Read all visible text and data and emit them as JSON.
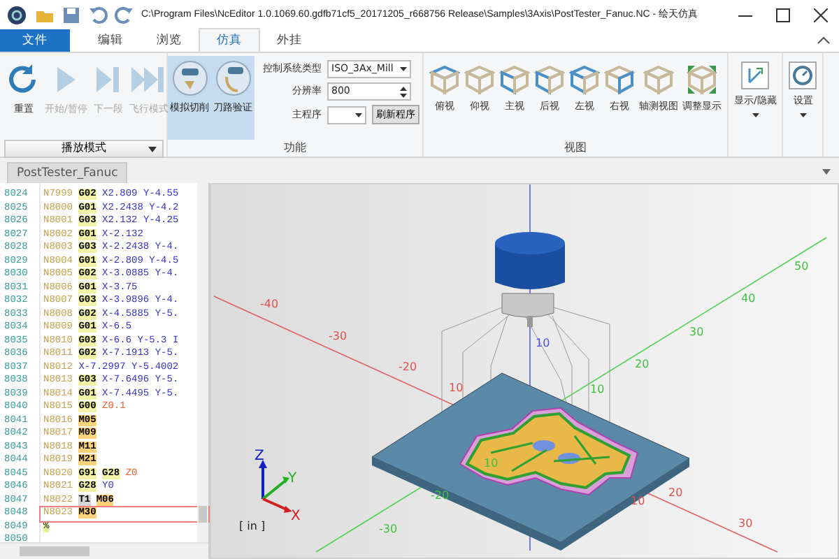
{
  "window": {
    "title": "C:\\Program Files\\NcEditor 1.0.1069.60.gdfb71cf5_20171205_r668756 Release\\Samples\\3Axis\\PostTester_Fanuc.NC - 绘天仿真"
  },
  "menu_tabs": [
    {
      "label": "文件",
      "kind": "file",
      "selected": false
    },
    {
      "label": "编辑",
      "kind": "tab",
      "selected": false
    },
    {
      "label": "浏览",
      "kind": "tab",
      "selected": false
    },
    {
      "label": "仿真",
      "kind": "tab",
      "selected": true
    },
    {
      "label": "外挂",
      "kind": "tab",
      "selected": false
    }
  ],
  "ribbon": {
    "playback": {
      "buttons": [
        {
          "label": "重置",
          "kind": "reset",
          "disabled": false
        },
        {
          "label": "开始/暂停",
          "kind": "play",
          "disabled": true
        },
        {
          "label": "下一段",
          "kind": "step",
          "disabled": true
        },
        {
          "label": "飞行模式",
          "kind": "fly",
          "disabled": true
        }
      ],
      "mode_dropdown": "播放模式"
    },
    "function": {
      "toggles": [
        {
          "label": "模拟切削",
          "selected": true
        },
        {
          "label": "刀路验证",
          "selected": true
        }
      ],
      "fields": [
        {
          "label": "控制系统类型",
          "kind": "select",
          "value": "ISO_3Ax_Mill"
        },
        {
          "label": "分辨率",
          "kind": "spinner",
          "value": "800"
        },
        {
          "label": "主程序",
          "kind": "select",
          "action": "刷新程序"
        }
      ],
      "group_label": "功能"
    },
    "view": {
      "buttons": [
        "俯视",
        "仰视",
        "主视",
        "后视",
        "左视",
        "右视",
        "轴测视图",
        "调整显示"
      ],
      "group_label": "视图"
    },
    "display": {
      "label": "显示/隐藏"
    },
    "settings": {
      "label": "设置"
    }
  },
  "document_tab": "PostTester_Fanuc",
  "editor": {
    "lines": [
      {
        "number": "8024",
        "current": false,
        "tokens": [
          {
            "text": "N7999",
            "kind": "n"
          },
          {
            "text": "G02",
            "kind": "g"
          },
          {
            "text": "X2.809",
            "kind": "xy"
          },
          {
            "text": "Y-4.55",
            "kind": "xy"
          }
        ]
      },
      {
        "number": "8025",
        "current": false,
        "tokens": [
          {
            "text": "N8000",
            "kind": "n"
          },
          {
            "text": "G01",
            "kind": "g"
          },
          {
            "text": "X2.2438",
            "kind": "xy"
          },
          {
            "text": "Y-4.2",
            "kind": "xy"
          }
        ]
      },
      {
        "number": "8026",
        "current": false,
        "tokens": [
          {
            "text": "N8001",
            "kind": "n"
          },
          {
            "text": "G03",
            "kind": "g"
          },
          {
            "text": "X2.132",
            "kind": "xy"
          },
          {
            "text": "Y-4.25",
            "kind": "xy"
          }
        ]
      },
      {
        "number": "8027",
        "current": false,
        "tokens": [
          {
            "text": "N8002",
            "kind": "n"
          },
          {
            "text": "G01",
            "kind": "g"
          },
          {
            "text": "X-2.132",
            "kind": "xy"
          }
        ]
      },
      {
        "number": "8028",
        "current": false,
        "tokens": [
          {
            "text": "N8003",
            "kind": "n"
          },
          {
            "text": "G03",
            "kind": "g"
          },
          {
            "text": "X-2.2438",
            "kind": "xy"
          },
          {
            "text": "Y-4.",
            "kind": "xy"
          }
        ]
      },
      {
        "number": "8029",
        "current": false,
        "tokens": [
          {
            "text": "N8004",
            "kind": "n"
          },
          {
            "text": "G01",
            "kind": "g"
          },
          {
            "text": "X-2.809",
            "kind": "xy"
          },
          {
            "text": "Y-4.5",
            "kind": "xy"
          }
        ]
      },
      {
        "number": "8030",
        "current": false,
        "tokens": [
          {
            "text": "N8005",
            "kind": "n"
          },
          {
            "text": "G02",
            "kind": "g"
          },
          {
            "text": "X-3.0885",
            "kind": "xy"
          },
          {
            "text": "Y-4.",
            "kind": "xy"
          }
        ]
      },
      {
        "number": "8031",
        "current": false,
        "tokens": [
          {
            "text": "N8006",
            "kind": "n"
          },
          {
            "text": "G01",
            "kind": "g"
          },
          {
            "text": "X-3.75",
            "kind": "xy"
          }
        ]
      },
      {
        "number": "8032",
        "current": false,
        "tokens": [
          {
            "text": "N8007",
            "kind": "n"
          },
          {
            "text": "G03",
            "kind": "g"
          },
          {
            "text": "X-3.9896",
            "kind": "xy"
          },
          {
            "text": "Y-4.",
            "kind": "xy"
          }
        ]
      },
      {
        "number": "8033",
        "current": false,
        "tokens": [
          {
            "text": "N8008",
            "kind": "n"
          },
          {
            "text": "G02",
            "kind": "g"
          },
          {
            "text": "X-4.5885",
            "kind": "xy"
          },
          {
            "text": "Y-5.",
            "kind": "xy"
          }
        ]
      },
      {
        "number": "8034",
        "current": false,
        "tokens": [
          {
            "text": "N8009",
            "kind": "n"
          },
          {
            "text": "G01",
            "kind": "g"
          },
          {
            "text": "X-6.5",
            "kind": "xy"
          }
        ]
      },
      {
        "number": "8035",
        "current": false,
        "tokens": [
          {
            "text": "N8010",
            "kind": "n"
          },
          {
            "text": "G03",
            "kind": "g"
          },
          {
            "text": "X-6.6",
            "kind": "xy"
          },
          {
            "text": "Y-5.3",
            "kind": "xy"
          },
          {
            "text": "I",
            "kind": "xy"
          }
        ]
      },
      {
        "number": "8036",
        "current": false,
        "tokens": [
          {
            "text": "N8011",
            "kind": "n"
          },
          {
            "text": "G02",
            "kind": "g"
          },
          {
            "text": "X-7.1913",
            "kind": "xy"
          },
          {
            "text": "Y-5.",
            "kind": "xy"
          }
        ]
      },
      {
        "number": "8037",
        "current": false,
        "tokens": [
          {
            "text": "N8012",
            "kind": "n"
          },
          {
            "text": "X-7.2997",
            "kind": "xy"
          },
          {
            "text": "Y-5.4002",
            "kind": "xy"
          }
        ]
      },
      {
        "number": "8038",
        "current": false,
        "tokens": [
          {
            "text": "N8013",
            "kind": "n"
          },
          {
            "text": "G03",
            "kind": "g"
          },
          {
            "text": "X-7.6496",
            "kind": "xy"
          },
          {
            "text": "Y-5.",
            "kind": "xy"
          }
        ]
      },
      {
        "number": "8039",
        "current": false,
        "tokens": [
          {
            "text": "N8014",
            "kind": "n"
          },
          {
            "text": "G01",
            "kind": "g"
          },
          {
            "text": "X-7.4495",
            "kind": "xy"
          },
          {
            "text": "Y-5.",
            "kind": "xy"
          }
        ]
      },
      {
        "number": "8040",
        "current": false,
        "tokens": [
          {
            "text": "N8015",
            "kind": "n"
          },
          {
            "text": "G00",
            "kind": "g"
          },
          {
            "text": "Z0.1",
            "kind": "z"
          }
        ]
      },
      {
        "number": "8041",
        "current": false,
        "tokens": [
          {
            "text": "N8016",
            "kind": "n"
          },
          {
            "text": "M05",
            "kind": "m"
          }
        ]
      },
      {
        "number": "8042",
        "current": false,
        "tokens": [
          {
            "text": "N8017",
            "kind": "n"
          },
          {
            "text": "M09",
            "kind": "m"
          }
        ]
      },
      {
        "number": "8043",
        "current": false,
        "tokens": [
          {
            "text": "N8018",
            "kind": "n"
          },
          {
            "text": "M11",
            "kind": "m"
          }
        ]
      },
      {
        "number": "8044",
        "current": false,
        "tokens": [
          {
            "text": "N8019",
            "kind": "n"
          },
          {
            "text": "M21",
            "kind": "m"
          }
        ]
      },
      {
        "number": "8045",
        "current": false,
        "tokens": [
          {
            "text": "N8020",
            "kind": "n"
          },
          {
            "text": "G91",
            "kind": "g"
          },
          {
            "text": "G28",
            "kind": "g"
          },
          {
            "text": "Z0",
            "kind": "z"
          }
        ]
      },
      {
        "number": "8046",
        "current": false,
        "tokens": [
          {
            "text": "N8021",
            "kind": "n"
          },
          {
            "text": "G28",
            "kind": "g"
          },
          {
            "text": "Y0",
            "kind": "xy"
          }
        ]
      },
      {
        "number": "8047",
        "current": false,
        "tokens": [
          {
            "text": "N8022",
            "kind": "n"
          },
          {
            "text": "T1",
            "kind": "t"
          },
          {
            "text": "M06",
            "kind": "m"
          }
        ]
      },
      {
        "number": "8048",
        "current": true,
        "tokens": [
          {
            "text": "N8023",
            "kind": "n"
          },
          {
            "text": "M30",
            "kind": "m"
          }
        ]
      },
      {
        "number": "8049",
        "current": false,
        "tokens": [
          {
            "text": "%",
            "kind": "end"
          }
        ]
      },
      {
        "number": "8050",
        "current": false
      }
    ]
  },
  "viewport": {
    "axis_labels": [
      {
        "text": "-40",
        "kind": "x"
      },
      {
        "text": "-30",
        "kind": "x"
      },
      {
        "text": "-20",
        "kind": "x"
      },
      {
        "text": "10",
        "kind": "x"
      },
      {
        "text": "10",
        "kind": "x"
      },
      {
        "text": "20",
        "kind": "x"
      },
      {
        "text": "30",
        "kind": "x"
      },
      {
        "text": "-30",
        "kind": "y"
      },
      {
        "text": "-20",
        "kind": "y"
      },
      {
        "text": "10",
        "kind": "y"
      },
      {
        "text": "10",
        "kind": "y"
      },
      {
        "text": "20",
        "kind": "y"
      },
      {
        "text": "30",
        "kind": "y"
      },
      {
        "text": "40",
        "kind": "y"
      },
      {
        "text": "50",
        "kind": "y"
      },
      {
        "text": "10",
        "kind": "z"
      }
    ],
    "triad": [
      {
        "text": "Z",
        "kind": "z"
      },
      {
        "text": "Y",
        "kind": "y"
      },
      {
        "text": "X",
        "kind": "x"
      }
    ],
    "unit": "[ in ]"
  }
}
